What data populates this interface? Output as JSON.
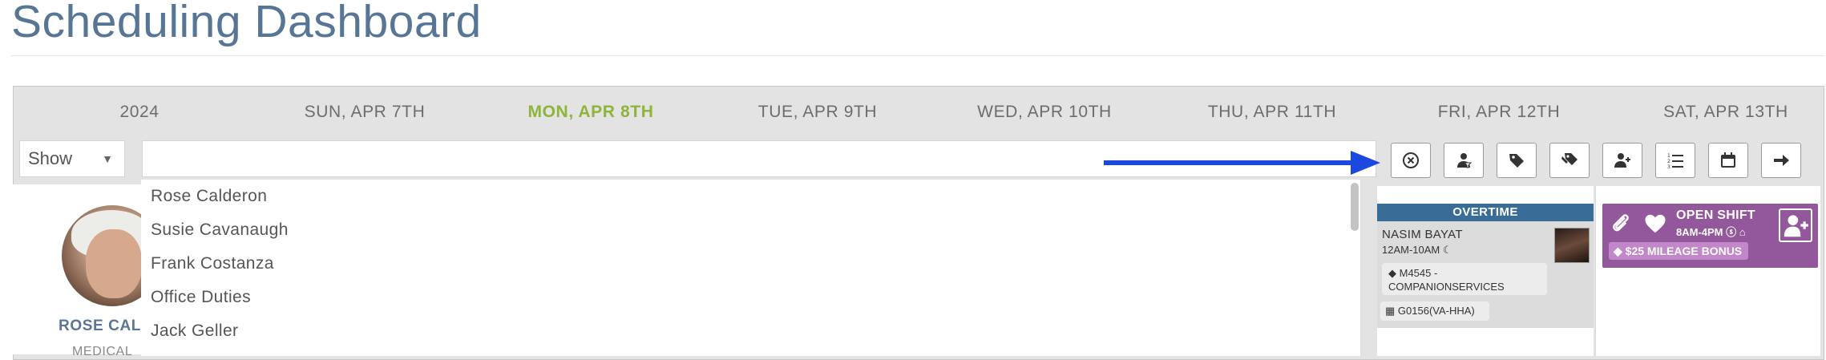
{
  "page": {
    "title": "Scheduling Dashboard"
  },
  "calendar": {
    "year": "2024",
    "days": [
      {
        "label": "SUN, APR 7TH",
        "today": false
      },
      {
        "label": "MON, APR 8TH",
        "today": true
      },
      {
        "label": "TUE, APR 9TH",
        "today": false
      },
      {
        "label": "WED, APR 10TH",
        "today": false
      },
      {
        "label": "THU, APR 11TH",
        "today": false
      },
      {
        "label": "FRI, APR 12TH",
        "today": false
      },
      {
        "label": "SAT, APR 13TH",
        "today": false
      }
    ],
    "today_color": "#8fb43a"
  },
  "toolbar": {
    "show_select": {
      "value": "Show"
    },
    "search": {
      "value": "",
      "placeholder": ""
    },
    "buttons": [
      {
        "icon": "clear-circle-icon"
      },
      {
        "icon": "person-filter-icon"
      },
      {
        "icon": "tag-icon"
      },
      {
        "icon": "tags-icon"
      },
      {
        "icon": "add-person-icon"
      },
      {
        "icon": "numbered-list-icon"
      },
      {
        "icon": "calendar-icon"
      },
      {
        "icon": "arrow-right-icon"
      }
    ]
  },
  "dropdown": {
    "items": [
      "Rose Calderon",
      "Susie Cavanaugh",
      "Frank Costanza",
      "Office Duties",
      "Jack Geller"
    ]
  },
  "person": {
    "name": "ROSE CALD",
    "subtitle": "MEDICAL"
  },
  "shifts": {
    "overtime": {
      "banner": "OVERTIME",
      "name": "NASIM BAYAT",
      "time": "12AM-10AM",
      "service": "M4545 - COMPANIONSERVICES",
      "code": "G0156(VA-HHA)",
      "banner_color": "#3a6c98"
    },
    "open": {
      "title": "OPEN SHIFT",
      "time": "8AM-4PM",
      "bonus": "$25 MILEAGE BONUS",
      "color": "#93579b"
    }
  },
  "annotation": {
    "arrow_color": "#1a48e0"
  }
}
